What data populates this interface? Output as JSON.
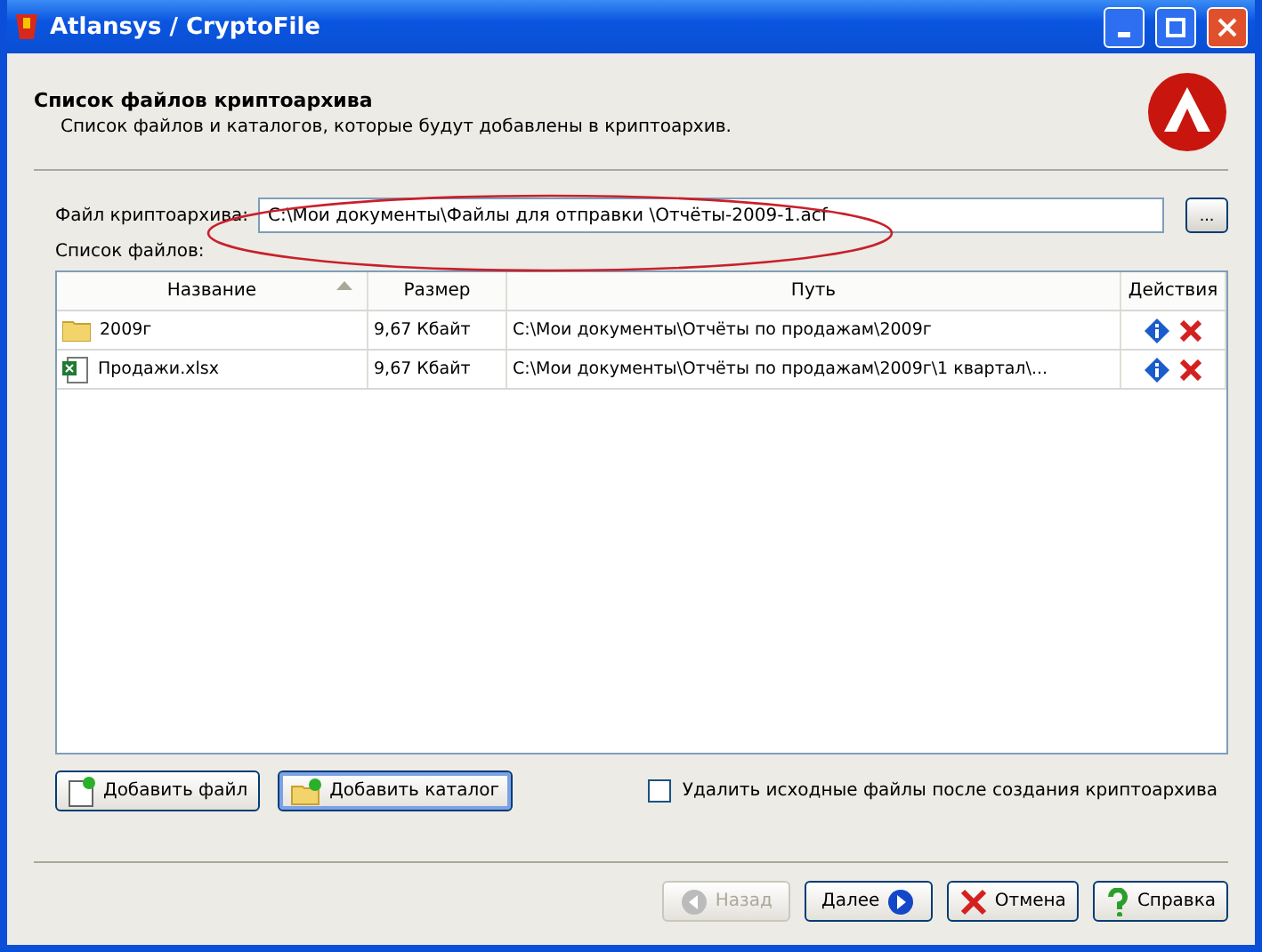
{
  "window": {
    "title": "Atlansys / CryptoFile"
  },
  "header": {
    "title": "Список файлов криптоархива",
    "subtitle": "Список файлов и каталогов, которые будут добавлены в криптоархив."
  },
  "archive_file": {
    "label": "Файл криптоархива:",
    "value": "C:\\Мои документы\\Файлы для отправки \\Отчёты-2009-1.acf",
    "browse": "..."
  },
  "files_label": "Список файлов:",
  "table": {
    "columns": [
      {
        "label": "Название",
        "sorted": true
      },
      {
        "label": "Размер",
        "sorted": false
      },
      {
        "label": "Путь",
        "sorted": false
      },
      {
        "label": "Действия",
        "sorted": false
      }
    ],
    "rows": [
      {
        "kind": "folder",
        "name": "2009г",
        "size": "9,67 Кбайт",
        "path": "C:\\Мои документы\\Отчёты по продажам\\2009г"
      },
      {
        "kind": "spreadsheet",
        "name": "Продажи.xlsx",
        "size": "9,67 Кбайт",
        "path": "C:\\Мои документы\\Отчёты по продажам\\2009г\\1 квартал\\..."
      }
    ]
  },
  "add_buttons": [
    {
      "kind": "file",
      "label": "Добавить файл",
      "focused": false
    },
    {
      "kind": "folder",
      "label": "Добавить каталог",
      "focused": true
    }
  ],
  "delete_sources": {
    "label": "Удалить исходные файлы после создания криптоархива",
    "checked": false
  },
  "nav_buttons": [
    {
      "kind": "back",
      "label": "Назад",
      "disabled": true
    },
    {
      "kind": "next",
      "label": "Далее",
      "disabled": false
    },
    {
      "kind": "cancel",
      "label": "Отмена",
      "disabled": false
    },
    {
      "kind": "help",
      "label": "Справка",
      "disabled": false
    }
  ]
}
